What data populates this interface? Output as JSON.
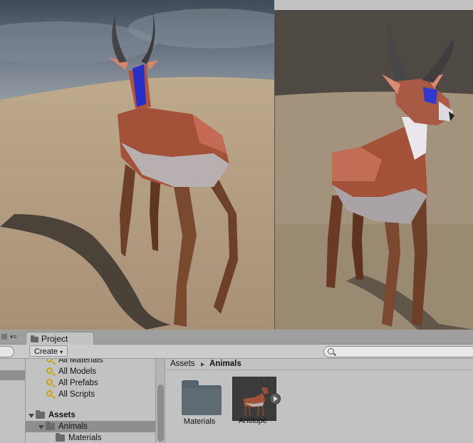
{
  "project_panel": {
    "tab_label": "Project",
    "create_label": "Create",
    "favorites": [
      {
        "label": "All Materials"
      },
      {
        "label": "All Models"
      },
      {
        "label": "All Prefabs"
      },
      {
        "label": "All Scripts"
      }
    ],
    "tree": {
      "assets_label": "Assets",
      "animals_label": "Animals",
      "materials_label": "Materials"
    },
    "breadcrumb": [
      "Assets",
      "Animals"
    ],
    "items": [
      {
        "name": "Materials",
        "icon": "folder-icon"
      },
      {
        "name": "Antilope",
        "icon": "prefab-thumbnail"
      }
    ]
  },
  "colors": {
    "sky": "#5b6b7f",
    "sand": "#b59e7f",
    "panel": "#c2c2c2",
    "selection": "#8e8e8e",
    "favorite": "#caa20a"
  }
}
